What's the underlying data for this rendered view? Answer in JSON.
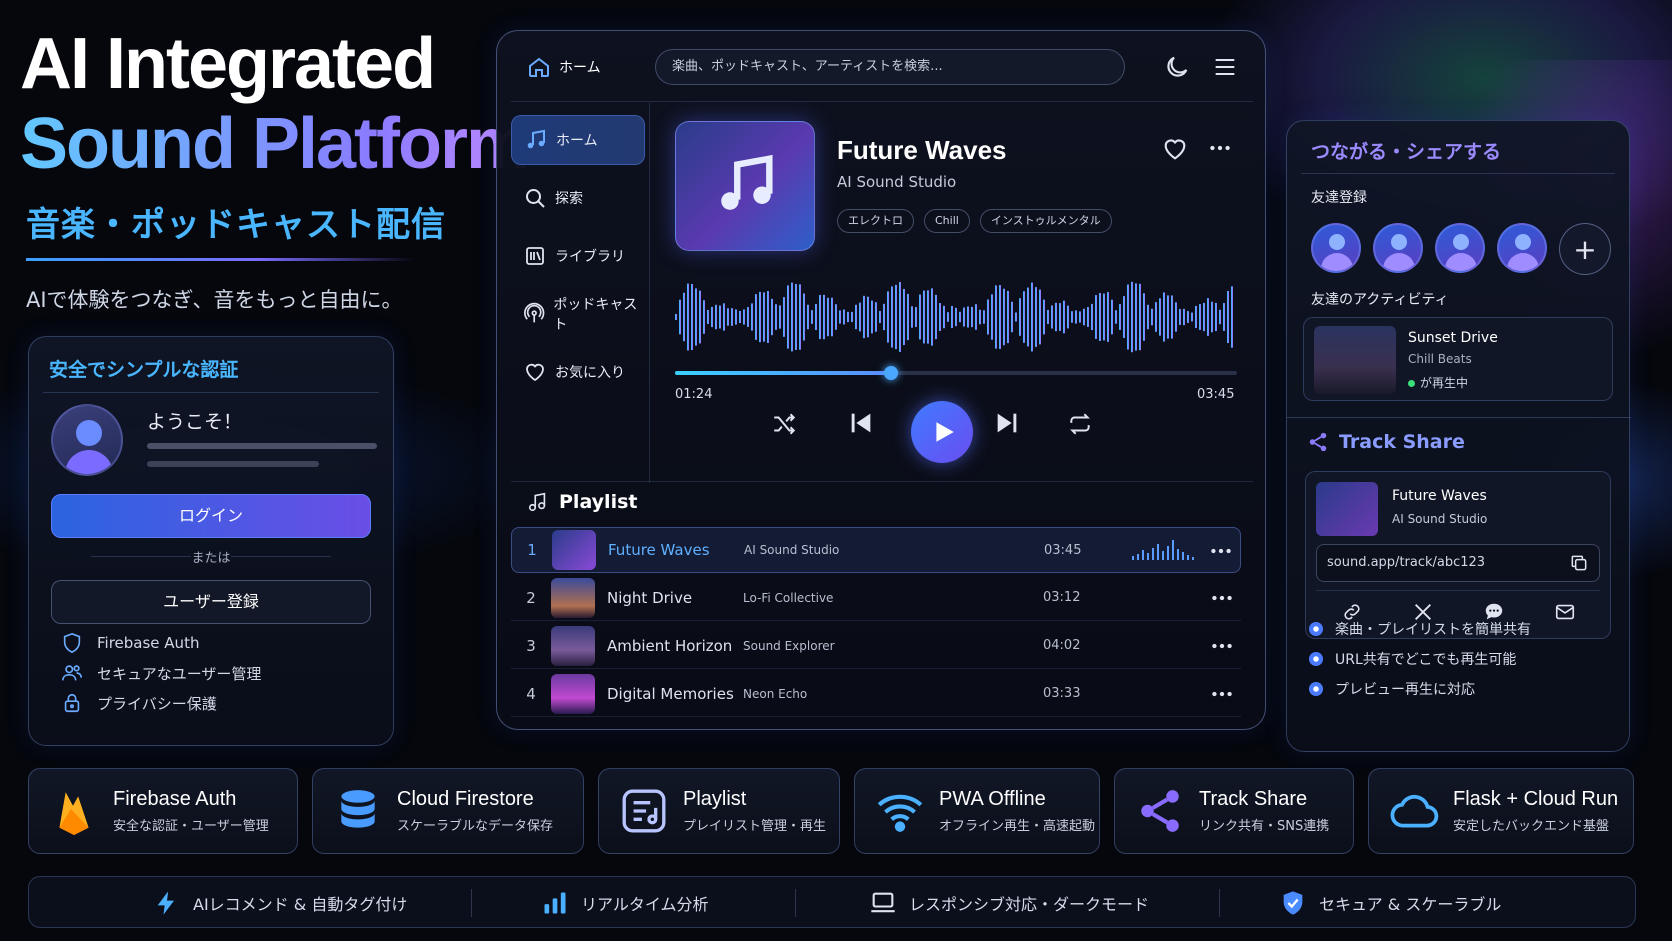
{
  "hero": {
    "title_line1": "AI Integrated",
    "title_line2": "Sound Platform",
    "subtitle": "音楽・ポッドキャスト配信",
    "tagline": "AIで体験をつなぎ、音をもっと自由に。"
  },
  "auth": {
    "title": "安全でシンプルな認証",
    "welcome": "ようこそ！",
    "login_label": "ログイン",
    "or_label": "または",
    "register_label": "ユーザー登録",
    "features": [
      "Firebase Auth",
      "セキュアなユーザー管理",
      "プライバシー保護"
    ]
  },
  "player": {
    "home_label": "ホーム",
    "search_placeholder": "楽曲、ポッドキャスト、アーティストを検索...",
    "sidebar": [
      "ホーム",
      "探索",
      "ライブラリ",
      "ポッドキャスト",
      "お気に入り"
    ],
    "now_playing": {
      "title": "Future Waves",
      "artist": "AI Sound Studio",
      "tags": [
        "エレクトロ",
        "Chill",
        "インストゥルメンタル"
      ],
      "current_time": "01:24",
      "total_time": "03:45",
      "progress": 0.385
    },
    "playlist_title": "Playlist",
    "playlist": [
      {
        "num": "1",
        "name": "Future Waves",
        "artist": "AI Sound Studio",
        "duration": "03:45"
      },
      {
        "num": "2",
        "name": "Night Drive",
        "artist": "Lo-Fi Collective",
        "duration": "03:12"
      },
      {
        "num": "3",
        "name": "Ambient Horizon",
        "artist": "Sound Explorer",
        "duration": "04:02"
      },
      {
        "num": "4",
        "name": "Digital Memories",
        "artist": "Neon Echo",
        "duration": "03:33"
      }
    ]
  },
  "connect": {
    "title": "つながる・シェアする",
    "friends_label": "友達登録",
    "activity_label": "友達のアクティビティ",
    "activity": {
      "title": "Sunset Drive",
      "subtitle": "Chill Beats",
      "status": "が再生中"
    },
    "share_title": "Track Share",
    "share_track": {
      "title": "Future Waves",
      "artist": "AI Sound Studio"
    },
    "share_url": "sound.app/track/abc123",
    "bullets": [
      "楽曲・プレイリストを簡単共有",
      "URL共有でどこでも再生可能",
      "プレビュー再生に対応"
    ]
  },
  "features": [
    {
      "title": "Firebase Auth",
      "sub": "安全な認証・ユーザー管理",
      "icon": "firebase-icon"
    },
    {
      "title": "Cloud Firestore",
      "sub": "スケーラブルなデータ保存",
      "icon": "database-icon"
    },
    {
      "title": "Playlist",
      "sub": "プレイリスト管理・再生",
      "icon": "playlist-icon"
    },
    {
      "title": "PWA Offline",
      "sub": "オフライン再生・高速起動",
      "icon": "wifi-icon"
    },
    {
      "title": "Track Share",
      "sub": "リンク共有・SNS連携",
      "icon": "share-icon"
    },
    {
      "title": "Flask + Cloud Run",
      "sub": "安定したバックエンド基盤",
      "icon": "cloud-icon"
    }
  ],
  "bottom_bar": [
    "AIレコメンド & 自動タグ付け",
    "リアルタイム分析",
    "レスポンシブ対応・ダークモード",
    "セキュア & スケーラブル"
  ],
  "colors": {
    "accent_blue": "#49b6ff",
    "accent_purple": "#8a7bff",
    "background": "#05070d"
  }
}
